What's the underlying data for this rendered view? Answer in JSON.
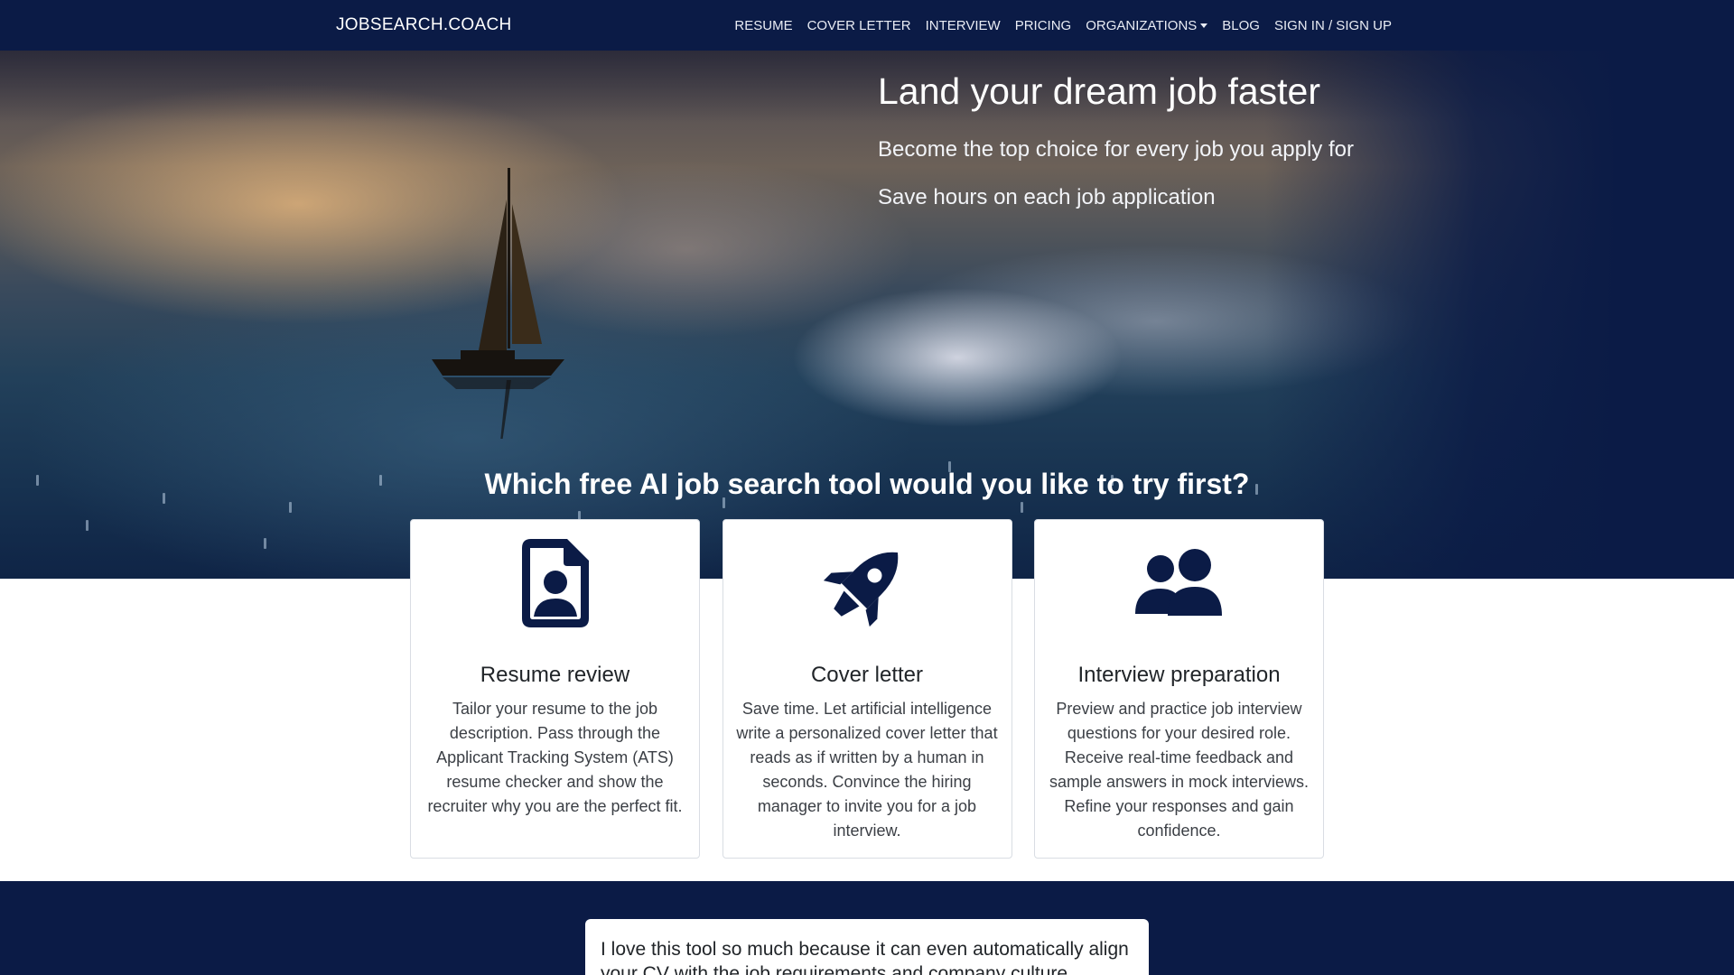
{
  "brand": "JOBSEARCH.COACH",
  "nav": {
    "items": [
      "RESUME",
      "COVER LETTER",
      "INTERVIEW",
      "PRICING"
    ],
    "organizations": "ORGANIZATIONS",
    "blog": "BLOG",
    "signin": "SIGN IN / SIGN UP"
  },
  "hero": {
    "title": "Land your dream job faster",
    "subtitle1": "Become the top choice for every job you apply for",
    "subtitle2": "Save hours on each job application",
    "question": "Which free AI job search tool would you like to try first?"
  },
  "cards": [
    {
      "icon": "file-user-icon",
      "title": "Resume review",
      "text": "Tailor your resume to the job description. Pass through the Applicant Tracking System (ATS) resume checker and show the recruiter why you are the perfect fit."
    },
    {
      "icon": "rocket-icon",
      "title": "Cover letter",
      "text": "Save time. Let artificial intelligence write a personalized cover letter that reads as if written by a human in seconds. Convince the hiring manager to invite you for a job interview."
    },
    {
      "icon": "users-icon",
      "title": "Interview preparation",
      "text": "Preview and practice job interview questions for your desired role. Receive real-time feedback and sample answers in mock interviews. Refine your responses and gain confidence."
    }
  ],
  "testimonial": {
    "text": "I love this tool so much because it can even automatically align your CV with the job requirements and company culture."
  },
  "colors": {
    "navy": "#0b1b46",
    "icon": "#0b1b46"
  }
}
